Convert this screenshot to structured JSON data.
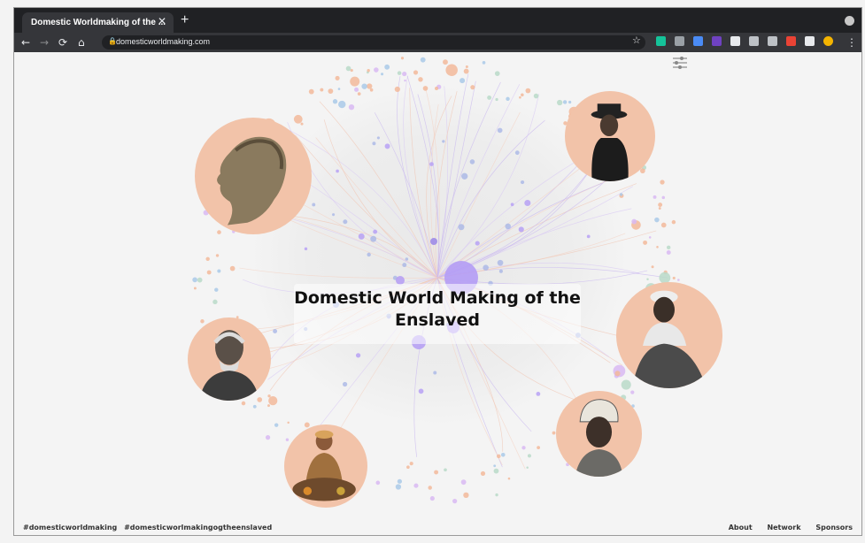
{
  "browser": {
    "tab_title": "Domestic Worldmaking of the ...",
    "tab_close": "✕",
    "new_tab": "+",
    "url": "domesticworldmaking.com",
    "nav": {
      "back": "←",
      "forward": "→",
      "reload": "⟳",
      "home": "⌂"
    },
    "star": "☆",
    "menu": "⋮",
    "extensions": [
      {
        "name": "grammarly-icon",
        "color": "#15c39a"
      },
      {
        "name": "extension-a-icon",
        "color": "#9aa0a6"
      },
      {
        "name": "extension-blue-icon",
        "color": "#4a8bf5"
      },
      {
        "name": "extension-b-icon",
        "color": "#6f42c1"
      },
      {
        "name": "document-icon",
        "color": "#e8eaed"
      },
      {
        "name": "extension-grey-icon",
        "color": "#bdc1c6"
      },
      {
        "name": "extension-hand-icon",
        "color": "#bdc1c6"
      },
      {
        "name": "extension-red-icon",
        "color": "#ea4335"
      },
      {
        "name": "puzzle-icon",
        "color": "#e8eaed"
      },
      {
        "name": "profile-avatar-icon",
        "color": "#f4b400"
      }
    ]
  },
  "page": {
    "title": "Domestic World Making of the Enslaved",
    "hashtags": [
      "#domesticworldmaking",
      "#domesticworlmakingogtheenslaved"
    ],
    "footer_links": [
      "About",
      "Network",
      "Sponsors"
    ]
  },
  "colors": {
    "accent_purple": "#b49cf5",
    "portrait_bg": "#f2c3a9",
    "node_peach": "#f2b89a"
  }
}
